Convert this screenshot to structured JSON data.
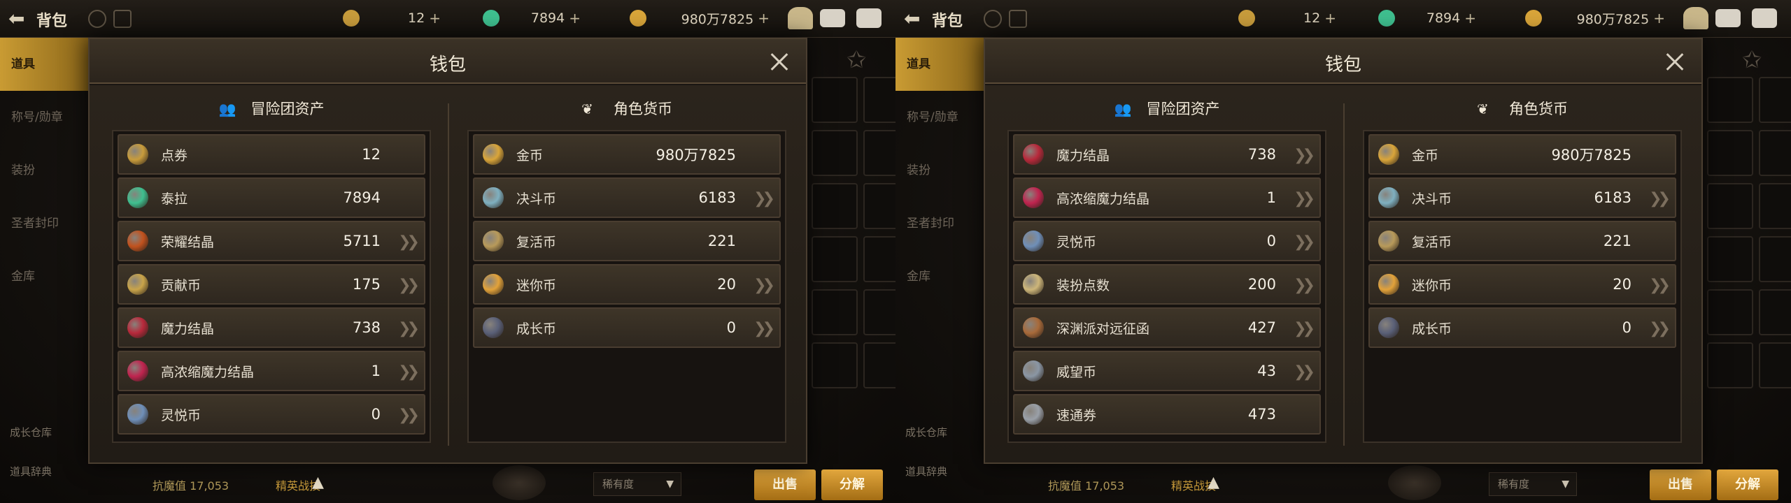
{
  "screens": [
    {
      "topbar": {
        "title": "背包",
        "currencies": [
          {
            "icon": "moon-coupon-icon",
            "value": "12"
          },
          {
            "icon": "tera-gem-icon",
            "value": "7894"
          },
          {
            "icon": "gold-coin-icon",
            "value": "980万7825"
          }
        ]
      },
      "left_menu": [
        "道具",
        "称号/勋章",
        "装扮",
        "圣者封印",
        "金库"
      ],
      "left_bottom": [
        "成长仓库",
        "道具辞典"
      ],
      "bottom": {
        "power": "抗魔值 17,053",
        "status": "精英战技",
        "dropdown": "稀有度",
        "sell": "出售",
        "decompose": "分解"
      },
      "dialog": {
        "title": "钱包",
        "left_title": "冒险团资产",
        "right_title": "角色货币",
        "left_items": [
          {
            "icon": "coupon-icon",
            "name": "点券",
            "value": "12",
            "arrow": false,
            "color": "#c89c3c"
          },
          {
            "icon": "tera-icon",
            "name": "泰拉",
            "value": "7894",
            "arrow": false,
            "color": "#3fbf8f"
          },
          {
            "icon": "glory-crystal-icon",
            "name": "荣耀结晶",
            "value": "5711",
            "arrow": true,
            "color": "#c1521e"
          },
          {
            "icon": "contribution-coin-icon",
            "name": "贡献币",
            "value": "175",
            "arrow": true,
            "color": "#c9a44a"
          },
          {
            "icon": "magic-crystal-icon",
            "name": "魔力结晶",
            "value": "738",
            "arrow": true,
            "color": "#b8293b"
          },
          {
            "icon": "condensed-crystal-icon",
            "name": "高浓缩魔力结晶",
            "value": "1",
            "arrow": true,
            "color": "#c0244f"
          },
          {
            "icon": "spirit-coin-icon",
            "name": "灵悦币",
            "value": "0",
            "arrow": true,
            "color": "#6f8fb8"
          }
        ],
        "right_items": [
          {
            "icon": "gold-icon",
            "name": "金币",
            "value": "980万7825",
            "arrow": false,
            "color": "#d9a53a"
          },
          {
            "icon": "duel-coin-icon",
            "name": "决斗币",
            "value": "6183",
            "arrow": true,
            "color": "#7fb0c0"
          },
          {
            "icon": "revive-coin-icon",
            "name": "复活币",
            "value": "221",
            "arrow": false,
            "color": "#b89a5a"
          },
          {
            "icon": "mini-coin-icon",
            "name": "迷你币",
            "value": "20",
            "arrow": true,
            "color": "#e2a23a"
          },
          {
            "icon": "growth-coin-icon",
            "name": "成长币",
            "value": "0",
            "arrow": true,
            "color": "#5a6078"
          }
        ]
      }
    },
    {
      "topbar": {
        "title": "背包",
        "currencies": [
          {
            "icon": "moon-coupon-icon",
            "value": "12"
          },
          {
            "icon": "tera-gem-icon",
            "value": "7894"
          },
          {
            "icon": "gold-coin-icon",
            "value": "980万7825"
          }
        ]
      },
      "left_menu": [
        "道具",
        "称号/勋章",
        "装扮",
        "圣者封印",
        "金库"
      ],
      "left_bottom": [
        "成长仓库",
        "道具辞典"
      ],
      "bottom": {
        "power": "抗魔值 17,053",
        "status": "精英战技",
        "dropdown": "稀有度",
        "sell": "出售",
        "decompose": "分解"
      },
      "dialog": {
        "title": "钱包",
        "left_title": "冒险团资产",
        "right_title": "角色货币",
        "left_items": [
          {
            "icon": "magic-crystal-icon",
            "name": "魔力结晶",
            "value": "738",
            "arrow": true,
            "color": "#b8293b"
          },
          {
            "icon": "condensed-crystal-icon",
            "name": "高浓缩魔力结晶",
            "value": "1",
            "arrow": true,
            "color": "#c0244f"
          },
          {
            "icon": "spirit-coin-icon",
            "name": "灵悦币",
            "value": "0",
            "arrow": true,
            "color": "#6f8fb8"
          },
          {
            "icon": "costume-point-icon",
            "name": "装扮点数",
            "value": "200",
            "arrow": true,
            "color": "#cdb67a"
          },
          {
            "icon": "abyss-letter-icon",
            "name": "深渊派对远征函",
            "value": "427",
            "arrow": true,
            "color": "#a86a3a"
          },
          {
            "icon": "prestige-coin-icon",
            "name": "威望币",
            "value": "43",
            "arrow": true,
            "color": "#8a96a4"
          },
          {
            "icon": "express-ticket-icon",
            "name": "速通券",
            "value": "473",
            "arrow": false,
            "color": "#9aa0a8"
          }
        ],
        "right_items": [
          {
            "icon": "gold-icon",
            "name": "金币",
            "value": "980万7825",
            "arrow": false,
            "color": "#d9a53a"
          },
          {
            "icon": "duel-coin-icon",
            "name": "决斗币",
            "value": "6183",
            "arrow": true,
            "color": "#7fb0c0"
          },
          {
            "icon": "revive-coin-icon",
            "name": "复活币",
            "value": "221",
            "arrow": false,
            "color": "#b89a5a"
          },
          {
            "icon": "mini-coin-icon",
            "name": "迷你币",
            "value": "20",
            "arrow": true,
            "color": "#e2a23a"
          },
          {
            "icon": "growth-coin-icon",
            "name": "成长币",
            "value": "0",
            "arrow": true,
            "color": "#5a6078"
          }
        ]
      }
    }
  ]
}
